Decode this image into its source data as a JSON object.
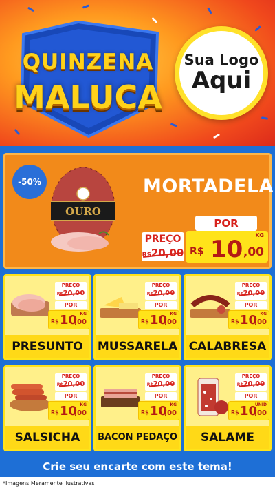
{
  "header": {
    "title_line1": "QUINZENA",
    "title_line2": "MALUCA",
    "logo_line1": "Sua Logo",
    "logo_line2": "Aqui"
  },
  "colors": {
    "blue": "#1e6fd6",
    "orange": "#f28a1a",
    "yellow": "#ffe31a",
    "red": "#d7231d"
  },
  "hero": {
    "discount": "-50%",
    "name": "MORTADELA",
    "brand": "OURO",
    "preco_label": "PREÇO",
    "old_currency": "R$",
    "old_price": "20,00",
    "por_label": "POR",
    "currency": "R$",
    "price_int": "10",
    "price_dec": ",00",
    "unit": "KG",
    "icon": "mortadela-icon"
  },
  "products": [
    {
      "name": "PRESUNTO",
      "preco_label": "PREÇO",
      "old_currency": "R$",
      "old_price": "20,00",
      "por_label": "POR",
      "currency": "R$",
      "price_int": "10",
      "price_dec": ",00",
      "unit": "KG",
      "icon": "presunto-icon"
    },
    {
      "name": "MUSSARELA",
      "preco_label": "PREÇO",
      "old_currency": "R$",
      "old_price": "20,00",
      "por_label": "POR",
      "currency": "R$",
      "price_int": "10",
      "price_dec": ",00",
      "unit": "KG",
      "icon": "mussarela-icon"
    },
    {
      "name": "CALABRESA",
      "preco_label": "PREÇO",
      "old_currency": "R$",
      "old_price": "20,00",
      "por_label": "POR",
      "currency": "R$",
      "price_int": "10",
      "price_dec": ",00",
      "unit": "KG",
      "icon": "calabresa-icon"
    },
    {
      "name": "SALSICHA",
      "preco_label": "PREÇO",
      "old_currency": "R$",
      "old_price": "20,00",
      "por_label": "POR",
      "currency": "R$",
      "price_int": "10",
      "price_dec": ",00",
      "unit": "KG",
      "icon": "salsicha-icon"
    },
    {
      "name": "BACON PEDAÇO",
      "preco_label": "PREÇO",
      "old_currency": "R$",
      "old_price": "20,00",
      "por_label": "POR",
      "currency": "R$",
      "price_int": "10",
      "price_dec": ",00",
      "unit": "KG",
      "icon": "bacon-icon"
    },
    {
      "name": "SALAME",
      "preco_label": "PREÇO",
      "old_currency": "R$",
      "old_price": "20,00",
      "por_label": "POR",
      "currency": "R$",
      "price_int": "10",
      "price_dec": ",00",
      "unit": "UNID",
      "icon": "salame-icon"
    }
  ],
  "cta": "Crie seu encarte com este tema!",
  "disclaimer": "*Imagens Meramente Ilustrativas"
}
